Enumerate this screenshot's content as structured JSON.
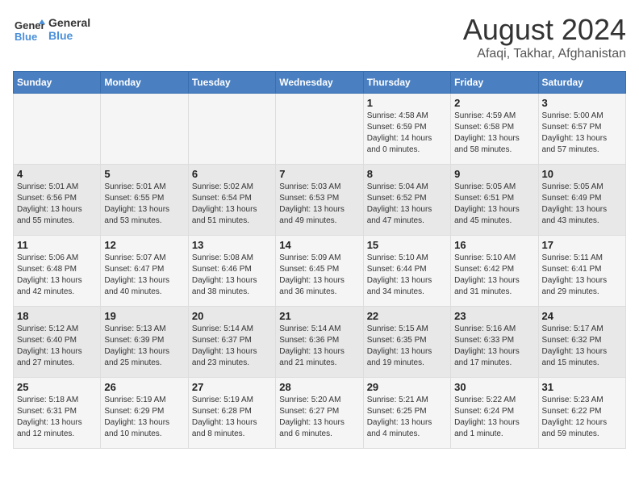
{
  "logo": {
    "line1": "General",
    "line2": "Blue"
  },
  "title": "August 2024",
  "subtitle": "Afaqi, Takhar, Afghanistan",
  "headers": [
    "Sunday",
    "Monday",
    "Tuesday",
    "Wednesday",
    "Thursday",
    "Friday",
    "Saturday"
  ],
  "weeks": [
    [
      {
        "day": "",
        "info": ""
      },
      {
        "day": "",
        "info": ""
      },
      {
        "day": "",
        "info": ""
      },
      {
        "day": "",
        "info": ""
      },
      {
        "day": "1",
        "info": "Sunrise: 4:58 AM\nSunset: 6:59 PM\nDaylight: 14 hours\nand 0 minutes."
      },
      {
        "day": "2",
        "info": "Sunrise: 4:59 AM\nSunset: 6:58 PM\nDaylight: 13 hours\nand 58 minutes."
      },
      {
        "day": "3",
        "info": "Sunrise: 5:00 AM\nSunset: 6:57 PM\nDaylight: 13 hours\nand 57 minutes."
      }
    ],
    [
      {
        "day": "4",
        "info": "Sunrise: 5:01 AM\nSunset: 6:56 PM\nDaylight: 13 hours\nand 55 minutes."
      },
      {
        "day": "5",
        "info": "Sunrise: 5:01 AM\nSunset: 6:55 PM\nDaylight: 13 hours\nand 53 minutes."
      },
      {
        "day": "6",
        "info": "Sunrise: 5:02 AM\nSunset: 6:54 PM\nDaylight: 13 hours\nand 51 minutes."
      },
      {
        "day": "7",
        "info": "Sunrise: 5:03 AM\nSunset: 6:53 PM\nDaylight: 13 hours\nand 49 minutes."
      },
      {
        "day": "8",
        "info": "Sunrise: 5:04 AM\nSunset: 6:52 PM\nDaylight: 13 hours\nand 47 minutes."
      },
      {
        "day": "9",
        "info": "Sunrise: 5:05 AM\nSunset: 6:51 PM\nDaylight: 13 hours\nand 45 minutes."
      },
      {
        "day": "10",
        "info": "Sunrise: 5:05 AM\nSunset: 6:49 PM\nDaylight: 13 hours\nand 43 minutes."
      }
    ],
    [
      {
        "day": "11",
        "info": "Sunrise: 5:06 AM\nSunset: 6:48 PM\nDaylight: 13 hours\nand 42 minutes."
      },
      {
        "day": "12",
        "info": "Sunrise: 5:07 AM\nSunset: 6:47 PM\nDaylight: 13 hours\nand 40 minutes."
      },
      {
        "day": "13",
        "info": "Sunrise: 5:08 AM\nSunset: 6:46 PM\nDaylight: 13 hours\nand 38 minutes."
      },
      {
        "day": "14",
        "info": "Sunrise: 5:09 AM\nSunset: 6:45 PM\nDaylight: 13 hours\nand 36 minutes."
      },
      {
        "day": "15",
        "info": "Sunrise: 5:10 AM\nSunset: 6:44 PM\nDaylight: 13 hours\nand 34 minutes."
      },
      {
        "day": "16",
        "info": "Sunrise: 5:10 AM\nSunset: 6:42 PM\nDaylight: 13 hours\nand 31 minutes."
      },
      {
        "day": "17",
        "info": "Sunrise: 5:11 AM\nSunset: 6:41 PM\nDaylight: 13 hours\nand 29 minutes."
      }
    ],
    [
      {
        "day": "18",
        "info": "Sunrise: 5:12 AM\nSunset: 6:40 PM\nDaylight: 13 hours\nand 27 minutes."
      },
      {
        "day": "19",
        "info": "Sunrise: 5:13 AM\nSunset: 6:39 PM\nDaylight: 13 hours\nand 25 minutes."
      },
      {
        "day": "20",
        "info": "Sunrise: 5:14 AM\nSunset: 6:37 PM\nDaylight: 13 hours\nand 23 minutes."
      },
      {
        "day": "21",
        "info": "Sunrise: 5:14 AM\nSunset: 6:36 PM\nDaylight: 13 hours\nand 21 minutes."
      },
      {
        "day": "22",
        "info": "Sunrise: 5:15 AM\nSunset: 6:35 PM\nDaylight: 13 hours\nand 19 minutes."
      },
      {
        "day": "23",
        "info": "Sunrise: 5:16 AM\nSunset: 6:33 PM\nDaylight: 13 hours\nand 17 minutes."
      },
      {
        "day": "24",
        "info": "Sunrise: 5:17 AM\nSunset: 6:32 PM\nDaylight: 13 hours\nand 15 minutes."
      }
    ],
    [
      {
        "day": "25",
        "info": "Sunrise: 5:18 AM\nSunset: 6:31 PM\nDaylight: 13 hours\nand 12 minutes."
      },
      {
        "day": "26",
        "info": "Sunrise: 5:19 AM\nSunset: 6:29 PM\nDaylight: 13 hours\nand 10 minutes."
      },
      {
        "day": "27",
        "info": "Sunrise: 5:19 AM\nSunset: 6:28 PM\nDaylight: 13 hours\nand 8 minutes."
      },
      {
        "day": "28",
        "info": "Sunrise: 5:20 AM\nSunset: 6:27 PM\nDaylight: 13 hours\nand 6 minutes."
      },
      {
        "day": "29",
        "info": "Sunrise: 5:21 AM\nSunset: 6:25 PM\nDaylight: 13 hours\nand 4 minutes."
      },
      {
        "day": "30",
        "info": "Sunrise: 5:22 AM\nSunset: 6:24 PM\nDaylight: 13 hours\nand 1 minute."
      },
      {
        "day": "31",
        "info": "Sunrise: 5:23 AM\nSunset: 6:22 PM\nDaylight: 12 hours\nand 59 minutes."
      }
    ]
  ]
}
